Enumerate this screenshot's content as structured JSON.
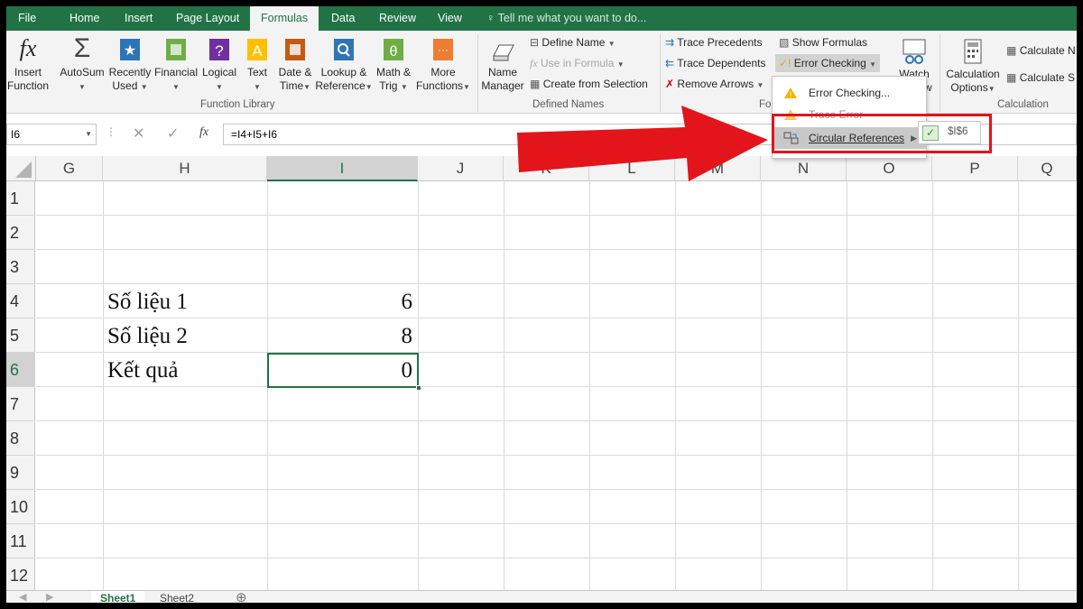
{
  "ribbon_tabs": [
    "File",
    "Home",
    "Insert",
    "Page Layout",
    "Formulas",
    "Data",
    "Review",
    "View"
  ],
  "active_tab": "Formulas",
  "tell_me": "Tell me what you want to do...",
  "function_library": {
    "insert_function": [
      "Insert",
      "Function"
    ],
    "autosum": "AutoSum",
    "recently_used": [
      "Recently",
      "Used"
    ],
    "financial": "Financial",
    "logical": "Logical",
    "text": "Text",
    "date_time": [
      "Date &",
      "Time"
    ],
    "lookup": [
      "Lookup &",
      "Reference"
    ],
    "math": [
      "Math &",
      "Trig"
    ],
    "more": [
      "More",
      "Functions"
    ],
    "group_label": "Function Library"
  },
  "defined_names": {
    "name_manager": [
      "Name",
      "Manager"
    ],
    "define_name": "Define Name",
    "use_in_formula": "Use in Formula",
    "create_from_selection": "Create from Selection",
    "group_label": "Defined Names"
  },
  "formula_auditing": {
    "trace_precedents": "Trace Precedents",
    "trace_dependents": "Trace Dependents",
    "remove_arrows": "Remove Arrows",
    "show_formulas": "Show Formulas",
    "error_checking": "Error Checking",
    "watch_window": [
      "Watch",
      "ow"
    ],
    "group_label": "Form"
  },
  "calculation": {
    "calc_options": [
      "Calculation",
      "Options"
    ],
    "calc_now": "Calculate N",
    "calc_sheet": "Calculate S",
    "group_label": "Calculation"
  },
  "dropdown": {
    "items": [
      "Error Checking...",
      "Trace Error",
      "Circular References"
    ],
    "submenu_value": "$I$6"
  },
  "formula_bar": {
    "name_box": "I6",
    "formula": "=I4+I5+I6",
    "fx": "fx"
  },
  "columns": [
    "G",
    "H",
    "I",
    "J",
    "K",
    "L",
    "M",
    "N",
    "O",
    "P",
    "Q"
  ],
  "rows": [
    "1",
    "2",
    "3",
    "4",
    "5",
    "6",
    "7",
    "8",
    "9",
    "10",
    "11",
    "12"
  ],
  "cells": {
    "h4": "Số liệu 1",
    "i4": "6",
    "h5": "Số liệu 2",
    "i5": "8",
    "h6": "Kết quả",
    "i6": "0"
  },
  "sheets": [
    "Sheet1",
    "Sheet2"
  ],
  "colors": {
    "excel_green": "#217346",
    "arrow_red": "#e3141a"
  }
}
